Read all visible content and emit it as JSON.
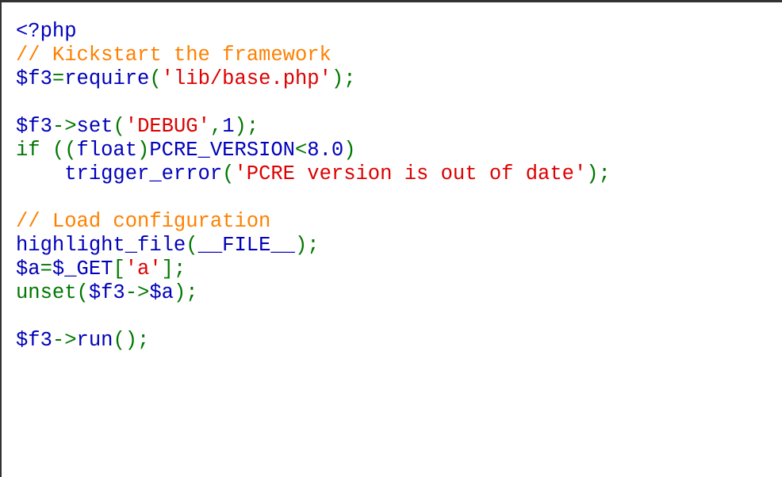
{
  "colors": {
    "default": "#0000BB",
    "keyword": "#007700",
    "string": "#DD0000",
    "comment": "#FF8000",
    "background": "#FFFFFF"
  },
  "code_lines": [
    [
      {
        "t": "default",
        "v": "<?php"
      }
    ],
    [
      {
        "t": "comment",
        "v": "// Kickstart the framework"
      }
    ],
    [
      {
        "t": "default",
        "v": "$f3"
      },
      {
        "t": "keyword",
        "v": "="
      },
      {
        "t": "default",
        "v": "require"
      },
      {
        "t": "keyword",
        "v": "("
      },
      {
        "t": "string",
        "v": "'lib/base.php'"
      },
      {
        "t": "keyword",
        "v": ");"
      }
    ],
    [],
    [
      {
        "t": "default",
        "v": "$f3"
      },
      {
        "t": "keyword",
        "v": "->"
      },
      {
        "t": "default",
        "v": "set"
      },
      {
        "t": "keyword",
        "v": "("
      },
      {
        "t": "string",
        "v": "'DEBUG'"
      },
      {
        "t": "keyword",
        "v": ","
      },
      {
        "t": "default",
        "v": "1"
      },
      {
        "t": "keyword",
        "v": ");"
      }
    ],
    [
      {
        "t": "keyword",
        "v": "if (("
      },
      {
        "t": "default",
        "v": "float"
      },
      {
        "t": "keyword",
        "v": ")"
      },
      {
        "t": "default",
        "v": "PCRE_VERSION"
      },
      {
        "t": "keyword",
        "v": "<"
      },
      {
        "t": "default",
        "v": "8.0"
      },
      {
        "t": "keyword",
        "v": ")"
      }
    ],
    [
      {
        "t": "default",
        "v": "    trigger_error"
      },
      {
        "t": "keyword",
        "v": "("
      },
      {
        "t": "string",
        "v": "'PCRE version is out of date'"
      },
      {
        "t": "keyword",
        "v": ");"
      }
    ],
    [],
    [
      {
        "t": "comment",
        "v": "// Load configuration"
      }
    ],
    [
      {
        "t": "default",
        "v": "highlight_file"
      },
      {
        "t": "keyword",
        "v": "("
      },
      {
        "t": "default",
        "v": "__FILE__"
      },
      {
        "t": "keyword",
        "v": ");"
      }
    ],
    [
      {
        "t": "default",
        "v": "$a"
      },
      {
        "t": "keyword",
        "v": "="
      },
      {
        "t": "default",
        "v": "$_GET"
      },
      {
        "t": "keyword",
        "v": "["
      },
      {
        "t": "string",
        "v": "'a'"
      },
      {
        "t": "keyword",
        "v": "];"
      }
    ],
    [
      {
        "t": "keyword",
        "v": "unset("
      },
      {
        "t": "default",
        "v": "$f3"
      },
      {
        "t": "keyword",
        "v": "->"
      },
      {
        "t": "default",
        "v": "$a"
      },
      {
        "t": "keyword",
        "v": ");"
      }
    ],
    [],
    [
      {
        "t": "default",
        "v": "$f3"
      },
      {
        "t": "keyword",
        "v": "->"
      },
      {
        "t": "default",
        "v": "run"
      },
      {
        "t": "keyword",
        "v": "();"
      }
    ]
  ]
}
